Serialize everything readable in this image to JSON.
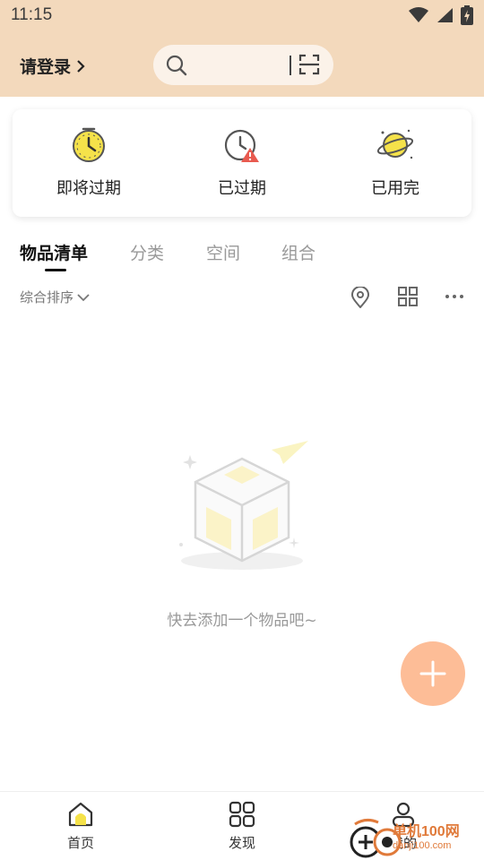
{
  "status_bar": {
    "time": "11:15"
  },
  "header": {
    "login_label": "请登录"
  },
  "quick_actions": [
    {
      "label": "即将过期",
      "icon": "clock-icon"
    },
    {
      "label": "已过期",
      "icon": "clock-warning-icon"
    },
    {
      "label": "已用完",
      "icon": "planet-icon"
    }
  ],
  "tabs": [
    {
      "label": "物品清单",
      "active": true
    },
    {
      "label": "分类",
      "active": false
    },
    {
      "label": "空间",
      "active": false
    },
    {
      "label": "组合",
      "active": false
    }
  ],
  "toolbar": {
    "sort_label": "综合排序"
  },
  "empty_state": {
    "message": "快去添加一个物品吧~"
  },
  "bottom_nav": [
    {
      "label": "首页",
      "icon": "home-icon",
      "active": true
    },
    {
      "label": "发现",
      "icon": "grid-icon",
      "active": false
    },
    {
      "label": "我的",
      "icon": "profile-icon",
      "active": false
    }
  ],
  "watermark": {
    "text": "单机100网",
    "url": "danji100.com"
  },
  "colors": {
    "header_bg": "#f3d9bc",
    "accent_yellow": "#f5e24a",
    "fab": "#fdbd97",
    "warning": "#e85a4f"
  }
}
